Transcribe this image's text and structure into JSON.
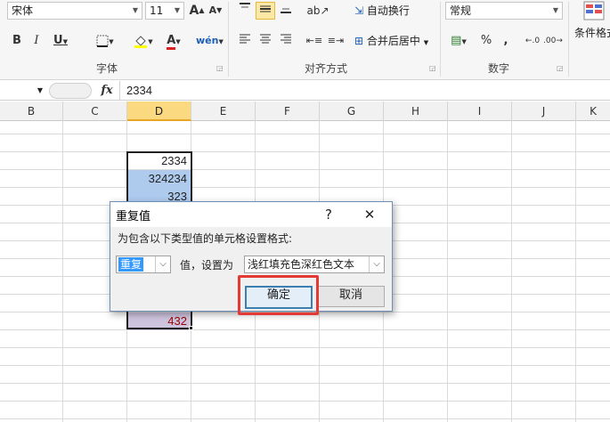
{
  "ribbon": {
    "font_name": "宋体",
    "font_size": "11",
    "wrap_text": "自动换行",
    "merge_center": "合并后居中",
    "number_format": "常规",
    "conditional_format": "条件格式",
    "group_font": "字体",
    "group_alignment": "对齐方式",
    "group_number": "数字",
    "grow_font": "A",
    "shrink_font": "A",
    "bold": "B",
    "italic": "I",
    "underline": "U",
    "font_color_glyph": "A",
    "percent": "%",
    "comma": ","
  },
  "formula_bar": {
    "fx": "fx",
    "value": "2334"
  },
  "columns": [
    "B",
    "C",
    "D",
    "E",
    "F",
    "G",
    "H",
    "I",
    "J",
    "K"
  ],
  "selected_column": "D",
  "cells": {
    "d1": "2334",
    "d2": "324234",
    "d3": "323",
    "d_last": "432"
  },
  "dialog": {
    "title": "重复值",
    "help": "?",
    "close": "✕",
    "prompt": "为包含以下类型值的单元格设置格式:",
    "type_value": "重复",
    "mid_label": "值，设置为",
    "format_value": "浅红填充色深红色文本",
    "ok": "确定",
    "cancel": "取消"
  },
  "colors": {
    "accent_highlight": "#aecbee",
    "red_text": "#9c0006",
    "annotation_red": "#e53935",
    "dialog_border": "#6f8fb6"
  }
}
